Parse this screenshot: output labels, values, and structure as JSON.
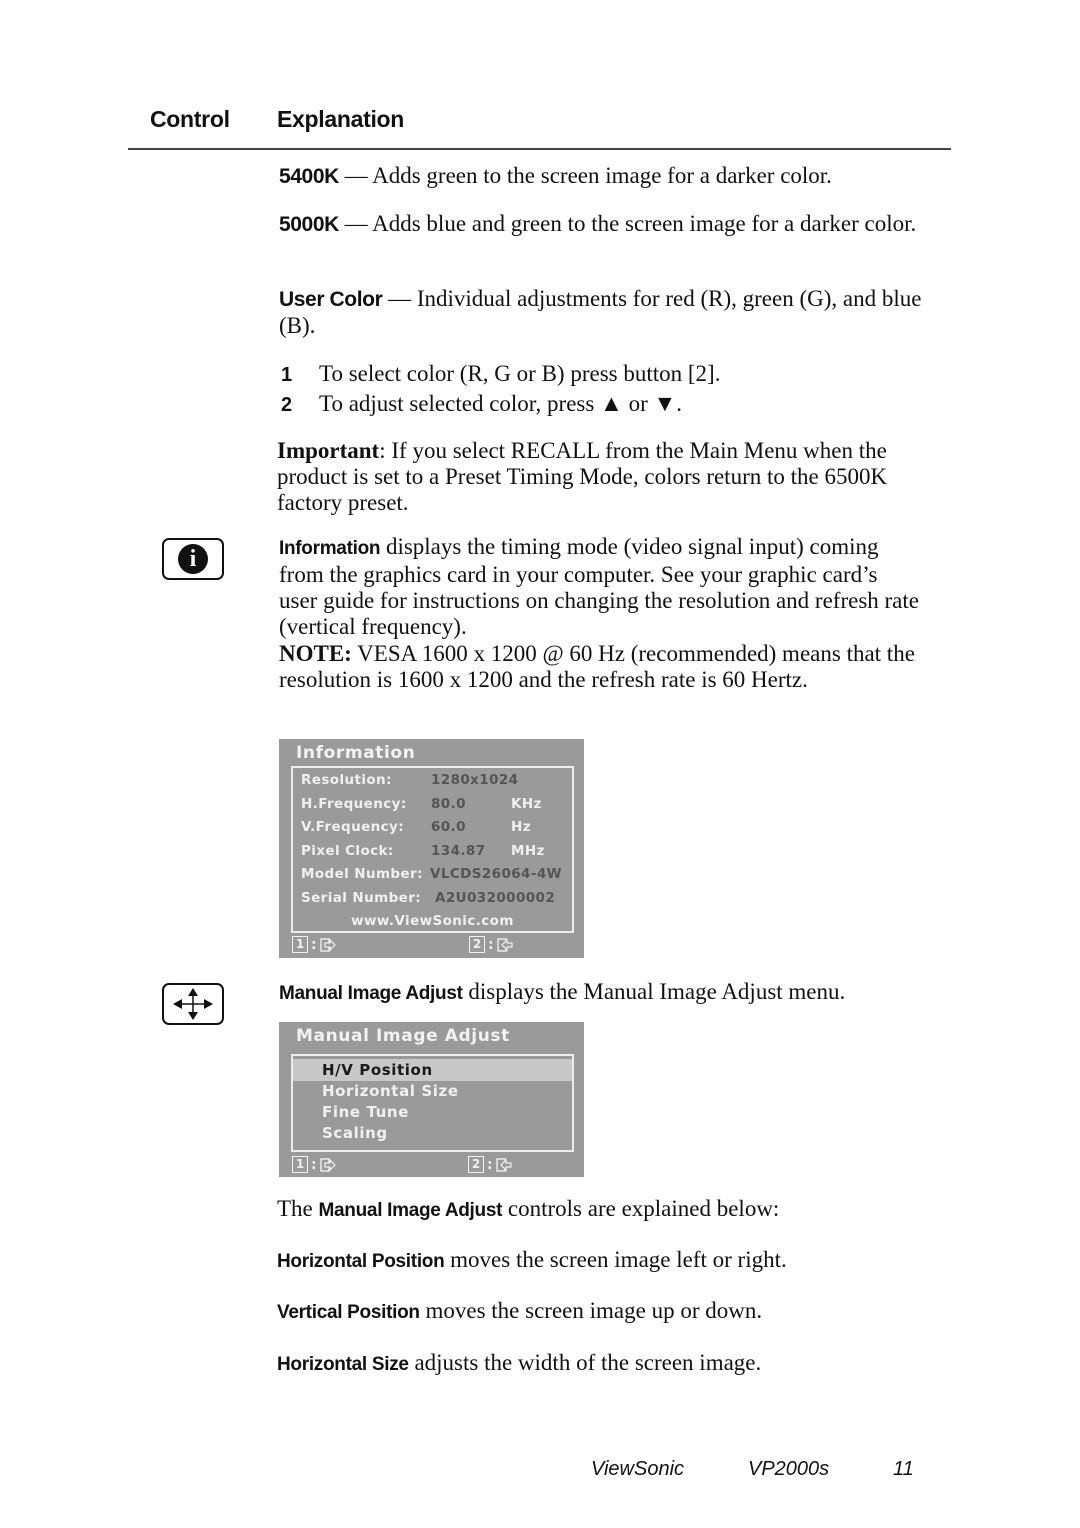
{
  "table_header": {
    "control": "Control",
    "explanation": "Explanation"
  },
  "color_options": [
    {
      "term": "5400K",
      "dash": " — ",
      "text": "Adds green to the screen image for a darker color."
    },
    {
      "term": "5000K",
      "dash": " — ",
      "text": "Adds blue and green to the screen image for a darker color."
    },
    {
      "term": "User Color",
      "dash": " — ",
      "text": "Individual adjustments for red (R), green (G), and blue (B)."
    }
  ],
  "steps": [
    {
      "num": "1",
      "text": "To select color (R, G or B) press button [2]."
    },
    {
      "num": "2",
      "text": "To adjust selected color, press ▲ or ▼."
    }
  ],
  "important": {
    "label": "Important",
    "text": ": If you select RECALL from the Main Menu when the product is set to a Preset Timing Mode, colors return to the 6500K factory preset."
  },
  "information": {
    "icon": "info-icon",
    "term": "Information",
    "text": " displays the timing mode (video signal input) coming from the graphics card in your computer. See your graphic card’s user guide for instructions on changing the resolution and refresh rate (vertical frequency).",
    "note_label": "NOTE:",
    "note_text": " VESA 1600 x 1200 @ 60 Hz (recommended) means that the resolution is 1600 x 1200 and the refresh rate is 60 Hertz."
  },
  "info_osd": {
    "title": "Information",
    "rows": [
      {
        "label": "Resolution:",
        "value": "1280x1024",
        "unit": ""
      },
      {
        "label": "H.Frequency:",
        "value": "80.0",
        "unit": "KHz"
      },
      {
        "label": "V.Frequency:",
        "value": "60.0",
        "unit": "Hz"
      },
      {
        "label": "Pixel Clock:",
        "value": "134.87",
        "unit": "MHz"
      },
      {
        "label": "Model Number:",
        "value": "VLCDS26064-4W",
        "unit": ""
      },
      {
        "label": "Serial Number:",
        "value": "A2U032000002",
        "unit": ""
      }
    ],
    "url": "www.ViewSonic.com",
    "footer": [
      {
        "key": "1",
        "sep": ":",
        "icon": "exit-icon"
      },
      {
        "key": "2",
        "sep": ":",
        "icon": "enter-icon"
      }
    ]
  },
  "manual_adjust": {
    "icon": "move-arrows-icon",
    "term": "Manual Image Adjust",
    "text": " displays the Manual Image Adjust menu."
  },
  "manual_osd": {
    "title": "Manual Image Adjust",
    "items": [
      {
        "label": "H/V Position",
        "selected": true
      },
      {
        "label": "Horizontal Size",
        "selected": false
      },
      {
        "label": "Fine Tune",
        "selected": false
      },
      {
        "label": "Scaling",
        "selected": false
      }
    ],
    "footer": [
      {
        "key": "1",
        "sep": ":",
        "icon": "exit-icon"
      },
      {
        "key": "2",
        "sep": ":",
        "icon": "enter-icon"
      }
    ]
  },
  "explained": {
    "prefix": "The ",
    "term": "Manual Image Adjust",
    "suffix": " controls are explained below:"
  },
  "controls": [
    {
      "term": "Horizontal Position",
      "text": " moves the screen image left or right."
    },
    {
      "term": "Vertical Position",
      "text": " moves the screen image up or down."
    },
    {
      "term": "Horizontal Size",
      "text": " adjusts the width of the screen image."
    }
  ],
  "footer": {
    "brand": "ViewSonic",
    "model": "VP2000s",
    "page": "11"
  }
}
